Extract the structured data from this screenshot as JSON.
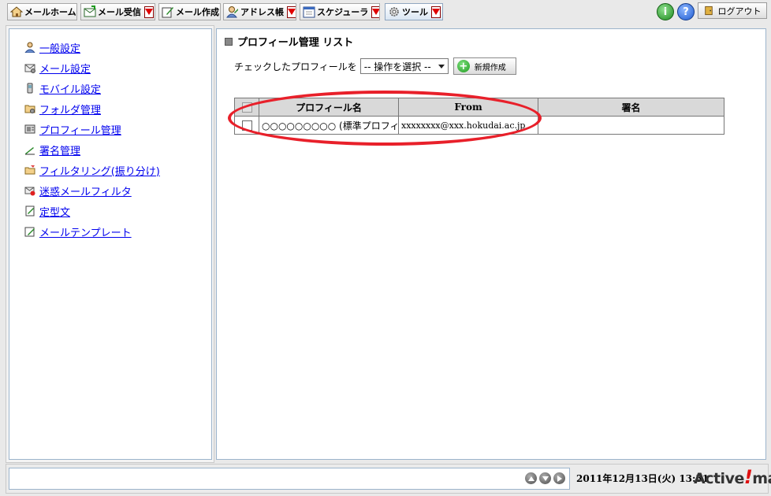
{
  "toolbar": {
    "tabs": [
      {
        "label": "メールホーム",
        "icon": "home-icon",
        "has_dropdown": false
      },
      {
        "label": "メール受信",
        "icon": "inbox-icon",
        "has_dropdown": true
      },
      {
        "label": "メール作成",
        "icon": "compose-icon",
        "has_dropdown": false
      },
      {
        "label": "アドレス帳",
        "icon": "address-book-icon",
        "has_dropdown": true
      },
      {
        "label": "スケジューラ",
        "icon": "calendar-icon",
        "has_dropdown": true
      },
      {
        "label": "ツール",
        "icon": "gear-icon",
        "has_dropdown": true,
        "active": true
      }
    ],
    "info_icon": "i",
    "help_icon": "?",
    "logout_label": "ログアウト"
  },
  "sidebar": {
    "items": [
      {
        "label": "一般設定",
        "icon": "user-settings-icon"
      },
      {
        "label": "メール設定",
        "icon": "mail-settings-icon"
      },
      {
        "label": "モバイル設定",
        "icon": "mobile-icon"
      },
      {
        "label": "フォルダ管理",
        "icon": "folder-icon"
      },
      {
        "label": "プロフィール管理",
        "icon": "profile-icon"
      },
      {
        "label": "署名管理",
        "icon": "signature-pen-icon"
      },
      {
        "label": "フィルタリング(振り分け)",
        "icon": "filter-icon"
      },
      {
        "label": "迷惑メールフィルタ",
        "icon": "spam-filter-icon"
      },
      {
        "label": "定型文",
        "icon": "template-text-icon"
      },
      {
        "label": "メールテンプレート",
        "icon": "mail-template-icon"
      }
    ]
  },
  "main": {
    "title": "プロフィール管理 リスト",
    "action_label": "チェックしたプロフィールを",
    "action_select": "-- 操作を選択 --",
    "new_button": "新規作成",
    "table": {
      "headers": [
        "プロフィール名",
        "From",
        "署名"
      ],
      "rows": [
        {
          "name": "○○○○○○○○○ (標準プロフィール)",
          "from": "xxxxxxxx@xxx.hokudai.ac.jp",
          "signature": ""
        }
      ]
    },
    "highlight_color": "#e8202a"
  },
  "status": {
    "datetime": "2011年12月13日(火) 13:31",
    "brand_prefix": "Active",
    "brand_mark": "!",
    "brand_suffix": "mail"
  }
}
